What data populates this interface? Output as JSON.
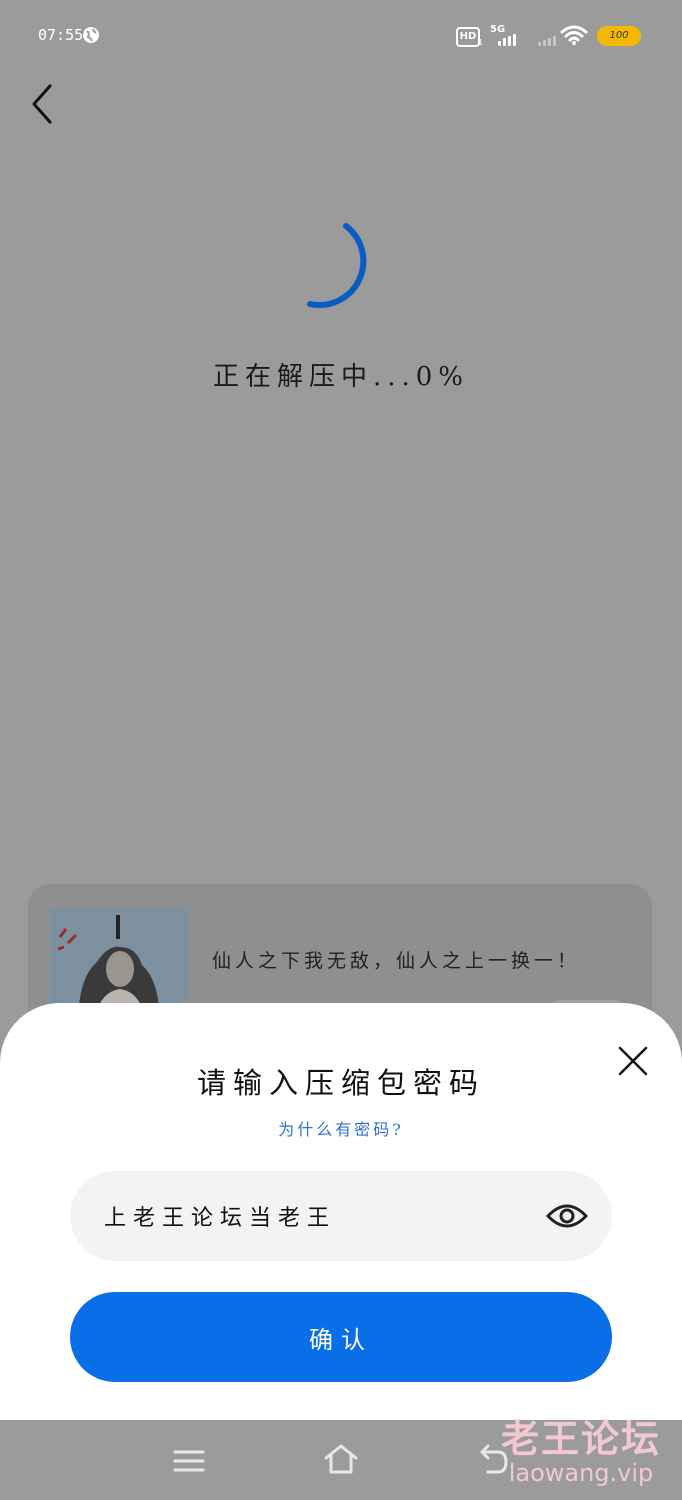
{
  "status_bar": {
    "time": "07:55",
    "hd_label": "HD",
    "hd_sub": "1",
    "network": "5G",
    "battery": "100"
  },
  "loading": {
    "text": "正在解压中...0%"
  },
  "card": {
    "text": "仙人之下我无敌，仙人之上一换一！"
  },
  "dialog": {
    "title": "请输入压缩包密码",
    "help_link": "为什么有密码?",
    "password_value": "上老王论坛当老王",
    "confirm_label": "确认"
  },
  "watermark": {
    "cn": "老王论坛",
    "en": "laowang.vip"
  },
  "colors": {
    "accent": "#0a6ee8",
    "link": "#2f6fd1",
    "spinner": "#0b5bc4",
    "battery": "#f5b800",
    "watermark": "#f3c8d3"
  }
}
